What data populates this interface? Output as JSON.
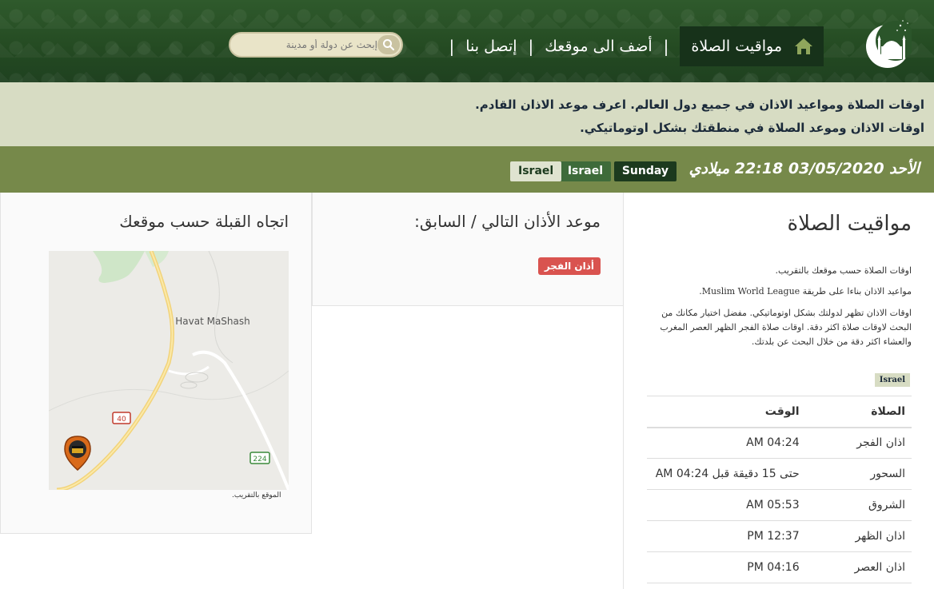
{
  "nav": {
    "home_label": "مواقيت الصلاة",
    "add_location_label": "أضف الى موقعك",
    "contact_label": "إتصل بنا",
    "separator": "|",
    "search_placeholder": "إبحث عن دولة أو مدينة"
  },
  "intro": {
    "line1": "اوقات الصلاة ومواعيد الاذان في جميع دول العالم. اعرف موعد الاذان القادم.",
    "line2": "اوقات الاذان وموعد الصلاة في منطقتك بشكل اوتوماتيكي."
  },
  "datebar": {
    "date_text": "الأحد 03/05/2020 22:18 ميلادي",
    "day_badge": "Sunday",
    "country_badge_1": "Israel",
    "country_badge_2": "Israel"
  },
  "prayer_times": {
    "title": "مواقيت الصلاة",
    "text1": "اوقات الصلاة حسب موقعك بالتقريب.",
    "text2": "مواعيد الاذان بناءا على طريقة Muslim World League.",
    "text3": "اوقات الاذان تظهر لدولتك بشكل اوتوماتيكي. مفضل اختيار مكانك من البحث لاوقات صلاة اكثر دقة. اوقات صلاة الفجر الظهر العصر المغرب والعشاء اكثر دقة من خلال البحث عن بلدتك.",
    "country_badge": "Israel",
    "header_prayer": "الصلاة",
    "header_time": "الوقت",
    "rows": [
      {
        "name": "اذان الفجر",
        "time": "04:24 AM"
      },
      {
        "name": "السحور",
        "time": "حتى 15 دقيقة قبل 04:24 AM"
      },
      {
        "name": "الشروق",
        "time": "05:53 AM"
      },
      {
        "name": "اذان الظهر",
        "time": "12:37 PM"
      },
      {
        "name": "اذان العصر",
        "time": "04:16 PM"
      }
    ]
  },
  "next_prayer": {
    "title": "موعد الأذان التالي / السابق:",
    "badge": "أذان الفجر"
  },
  "qibla": {
    "title": "اتجاه القبلة حسب موقعك",
    "map_place": "Havat MaShash",
    "road_40": "40",
    "road_224": "224",
    "caption": "الموقع بالتقريب."
  },
  "colors": {
    "header_green": "#244a22",
    "intro_bg": "#d7dcc3",
    "datebar_bg": "#76894a",
    "badge_dark": "#1c3a1e",
    "badge_red": "#d9534f"
  }
}
